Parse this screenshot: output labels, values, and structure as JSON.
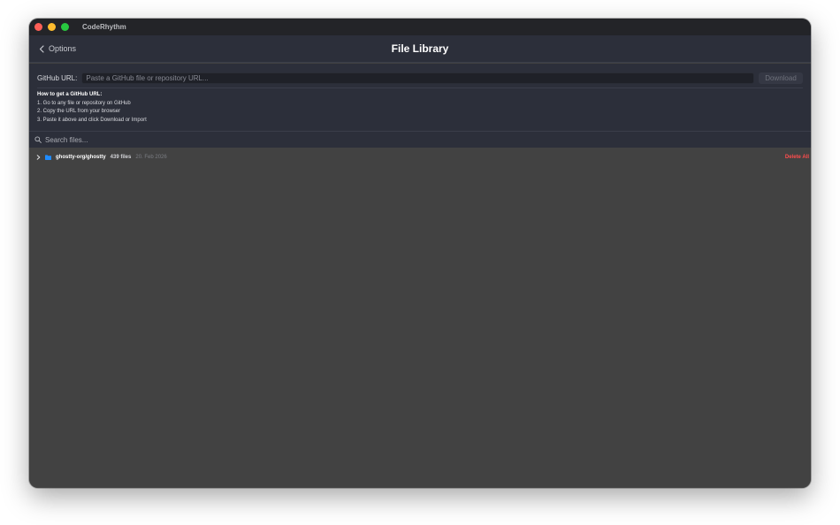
{
  "app": {
    "title": "CodeRhythm"
  },
  "header": {
    "back_label": "Options",
    "title": "File Library"
  },
  "url_panel": {
    "label": "GitHub URL:",
    "placeholder": "Paste a GitHub file or repository URL...",
    "value": "",
    "download_label": "Download",
    "howto_title": "How to get a GitHub URL:",
    "steps": [
      "1. Go to any file or repository on GitHub",
      "2. Copy the URL from your browser",
      "3. Paste it above and click Download or Import"
    ]
  },
  "search": {
    "placeholder": "Search files...",
    "value": ""
  },
  "library": {
    "repos": [
      {
        "name": "ghostty-org/ghostty",
        "count": "439 files",
        "date": "20. Feb 2026",
        "expanded": false
      }
    ],
    "delete_all_label": "Delete All"
  },
  "colors": {
    "window_bg": "#424242",
    "panel_bg": "#2c2f3a",
    "titlebar_bg": "#232428",
    "folder_blue": "#1f8cff",
    "delete_red": "#ff4d4d"
  },
  "icons": {
    "back": "chevron-left-icon",
    "search": "search-icon",
    "expand": "chevron-right-icon",
    "folder": "folder-icon"
  }
}
